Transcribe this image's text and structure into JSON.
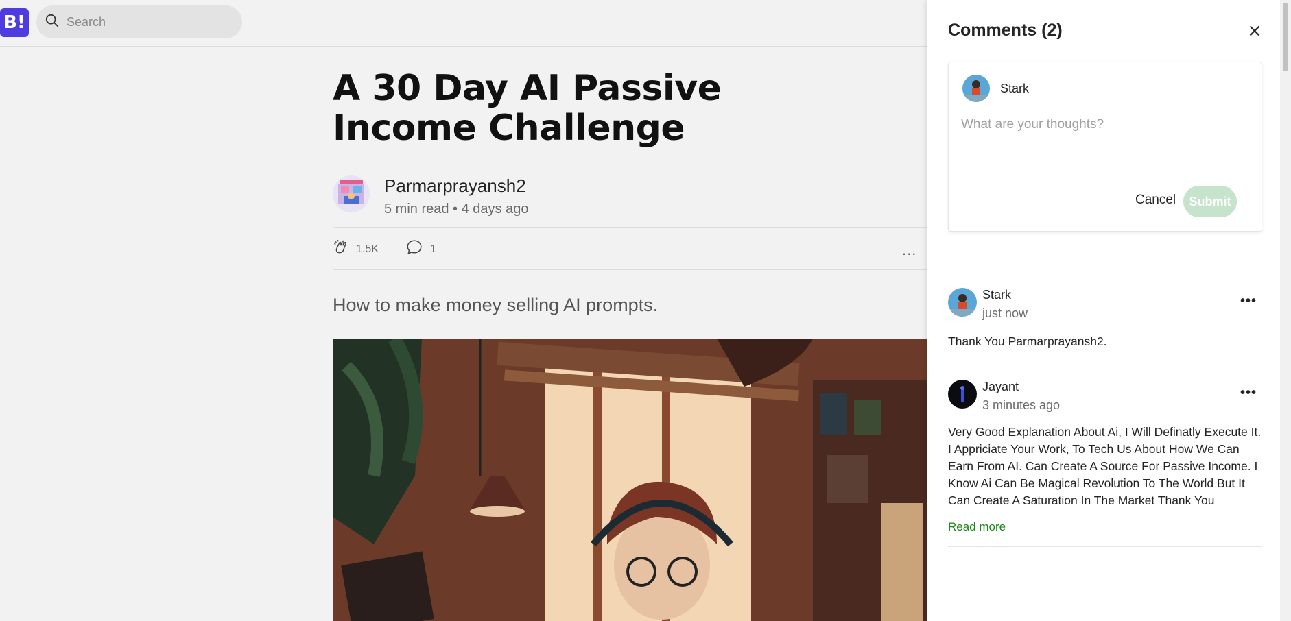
{
  "header": {
    "logo_text": "B!",
    "search_placeholder": "Search"
  },
  "article": {
    "title": "A 30 Day AI Passive Income Challenge",
    "author": "Parmarprayansh2",
    "meta": "5 min read • 4 days ago",
    "claps": "1.5K",
    "comments_count": "1",
    "more": "...",
    "subtitle": "How to make money selling AI prompts."
  },
  "comments_panel": {
    "title": "Comments (2)",
    "compose": {
      "user": "Stark",
      "placeholder": "What are your thoughts?",
      "cancel_label": "Cancel",
      "submit_label": "Submit"
    },
    "comments": [
      {
        "author": "Stark",
        "time": "just now",
        "text": "Thank You Parmarprayansh2."
      },
      {
        "author": "Jayant",
        "time": "3 minutes ago",
        "text": "Very Good Explanation About Ai, I Will Definatly Execute It. I Appriciate Your Work, To Tech Us About How We Can Earn From AI. Can Create A Source For Passive Income. I Know Ai Can Be Magical Revolution To The World But It Can Create A Saturation In The Market Thank You",
        "read_more": "Read more"
      }
    ]
  },
  "colors": {
    "brand": "#4f3ce0",
    "accent_green": "#1a8917",
    "submit_disabled": "#c6e3cc"
  }
}
